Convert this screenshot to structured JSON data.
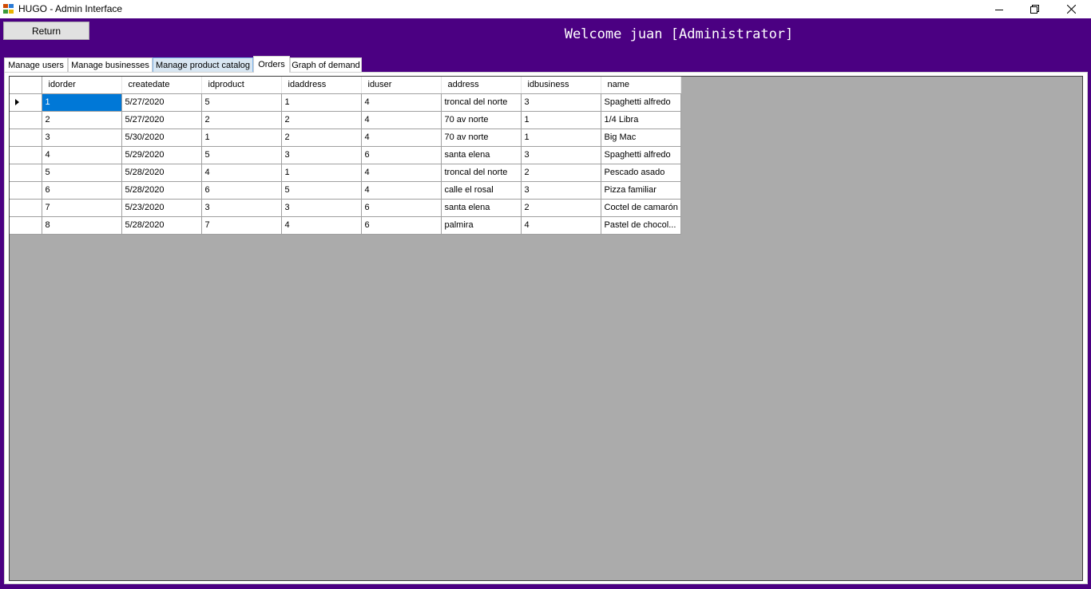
{
  "window": {
    "title": "HUGO - Admin Interface",
    "icon": "app-window-icon",
    "controls": [
      "minimize-icon",
      "restore-icon",
      "close-icon"
    ]
  },
  "header": {
    "return_label": "Return",
    "welcome_text": "Welcome juan [Administrator]",
    "background_color": "#4b0082"
  },
  "tabs": [
    {
      "label": "Manage users"
    },
    {
      "label": "Manage businesses"
    },
    {
      "label": "Manage product catalog"
    },
    {
      "label": "Orders"
    },
    {
      "label": "Graph of demand"
    }
  ],
  "active_tab": "Orders",
  "orders": {
    "columns": [
      "idorder",
      "createdate",
      "idproduct",
      "idaddress",
      "iduser",
      "address",
      "idbusiness",
      "name"
    ],
    "rows": [
      [
        "1",
        "5/27/2020",
        "5",
        "1",
        "4",
        "troncal del norte",
        "3",
        "Spaghetti alfredo"
      ],
      [
        "2",
        "5/27/2020",
        "2",
        "2",
        "4",
        "70 av norte",
        "1",
        "1/4 Libra"
      ],
      [
        "3",
        "5/30/2020",
        "1",
        "2",
        "4",
        "70 av norte",
        "1",
        "Big Mac"
      ],
      [
        "4",
        "5/29/2020",
        "5",
        "3",
        "6",
        "santa elena",
        "3",
        "Spaghetti alfredo"
      ],
      [
        "5",
        "5/28/2020",
        "4",
        "1",
        "4",
        "troncal del norte",
        "2",
        "Pescado asado"
      ],
      [
        "6",
        "5/28/2020",
        "6",
        "5",
        "4",
        "calle el rosal",
        "3",
        "Pizza familiar"
      ],
      [
        "7",
        "5/23/2020",
        "3",
        "3",
        "6",
        "santa elena",
        "2",
        "Coctel de camarón"
      ],
      [
        "8",
        "5/28/2020",
        "7",
        "4",
        "6",
        "palmira",
        "4",
        "Pastel de chocol..."
      ]
    ],
    "selected_cell": {
      "row": 0,
      "column": "idorder"
    },
    "selection_color": "#0078d7"
  }
}
